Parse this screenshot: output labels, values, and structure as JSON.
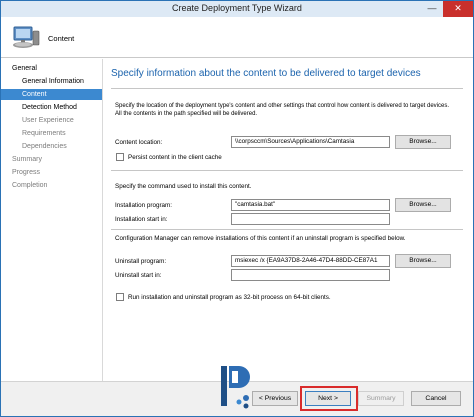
{
  "window": {
    "title": "Create Deployment Type Wizard",
    "minimize_glyph": "—",
    "close_glyph": "✕"
  },
  "header": {
    "title": "Content",
    "icon": "computer-icon"
  },
  "sidebar": {
    "items": [
      {
        "label": "General",
        "state": "normal"
      },
      {
        "label": "General Information",
        "state": "normal"
      },
      {
        "label": "Content",
        "state": "active"
      },
      {
        "label": "Detection Method",
        "state": "normal"
      },
      {
        "label": "User Experience",
        "state": "disabled"
      },
      {
        "label": "Requirements",
        "state": "disabled"
      },
      {
        "label": "Dependencies",
        "state": "disabled"
      },
      {
        "label": "Summary",
        "state": "disabled"
      },
      {
        "label": "Progress",
        "state": "disabled"
      },
      {
        "label": "Completion",
        "state": "disabled"
      }
    ]
  },
  "main": {
    "heading": "Specify information about the content to be delivered to target devices",
    "description": "Specify the location of the deployment type's content and other settings that control how content is delivered to target devices. All the contents in the path specified will be delivered.",
    "content_location": {
      "label": "Content location:",
      "value": "\\\\corpsccm\\Sources\\Applications\\Camtasia",
      "browse": "Browse..."
    },
    "persist_content": {
      "label": "Persist content in the client cache",
      "checked": false
    },
    "install_section": "Specify the command used to install this content.",
    "installation_program": {
      "label": "Installation program:",
      "value": "\"camtasia.bat\"",
      "browse": "Browse..."
    },
    "installation_start_in": {
      "label": "Installation start in:",
      "value": ""
    },
    "uninstall_section": "Configuration Manager can remove installations of this content if an uninstall program is specified below.",
    "uninstall_program": {
      "label": "Uninstall program:",
      "value": "msiexec /x {EA9A37D8-2A46-47D4-88DD-CE87A1",
      "browse": "Browse..."
    },
    "uninstall_start_in": {
      "label": "Uninstall start in:",
      "value": ""
    },
    "run_32bit": {
      "label": "Run installation and uninstall program as 32-bit process on 64-bit clients.",
      "checked": false
    }
  },
  "footer": {
    "previous": "< Previous",
    "next": "Next >",
    "summary": "Summary",
    "cancel": "Cancel"
  },
  "colors": {
    "accent": "#1b63ad",
    "active_nav": "#3c89d0",
    "highlight": "#d92b2b"
  },
  "watermark": {
    "letter": "P",
    "icon": "prajwal-desai-logo-icon"
  }
}
